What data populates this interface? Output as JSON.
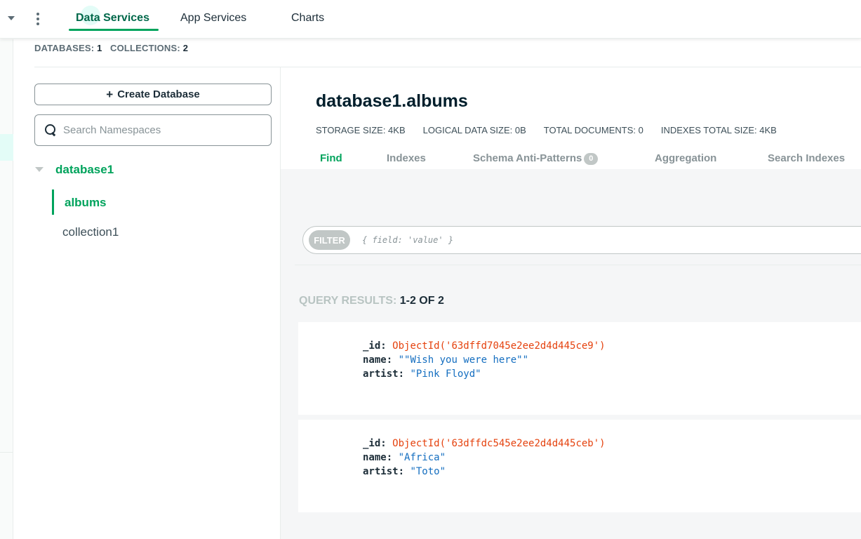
{
  "nav": {
    "tabs": [
      {
        "label": "Data Services"
      },
      {
        "label": "App Services"
      },
      {
        "label": "Charts"
      }
    ]
  },
  "counts": {
    "databases_label": "DATABASES:",
    "databases_value": "1",
    "collections_label": "COLLECTIONS:",
    "collections_value": "2"
  },
  "sidebar": {
    "create_label": "Create Database",
    "search_placeholder": "Search Namespaces",
    "database": "database1",
    "collections": [
      "albums",
      "collection1"
    ]
  },
  "main": {
    "title": "database1.albums",
    "stats": [
      "STORAGE SIZE: 4KB",
      "LOGICAL DATA SIZE: 0B",
      "TOTAL DOCUMENTS: 0",
      "INDEXES TOTAL SIZE: 4KB"
    ],
    "tabs": [
      "Find",
      "Indexes",
      "Schema Anti-Patterns",
      "Aggregation",
      "Search Indexes"
    ],
    "anti_patterns_count": "0",
    "filter_label": "FILTER",
    "filter_placeholder": "{ field: 'value' }",
    "results_label": "QUERY RESULTS:",
    "results_value": "1-2 OF 2"
  },
  "documents": [
    {
      "id": "ObjectId('63dffd7045e2ee2d4d445ce9')",
      "name": "\"\"Wish you were here\"\"",
      "artist": "\"Pink Floyd\""
    },
    {
      "id": "ObjectId('63dffdc545e2ee2d4d445ceb')",
      "name": "\"Africa\"",
      "artist": "\"Toto\""
    }
  ],
  "field_keys": {
    "id": "_id:",
    "name": "name:",
    "artist": "artist:"
  },
  "colors": {
    "accent": "#00a35c",
    "accent_dark": "#00684a",
    "objectid": "#e5420e",
    "string": "#146ec0"
  }
}
